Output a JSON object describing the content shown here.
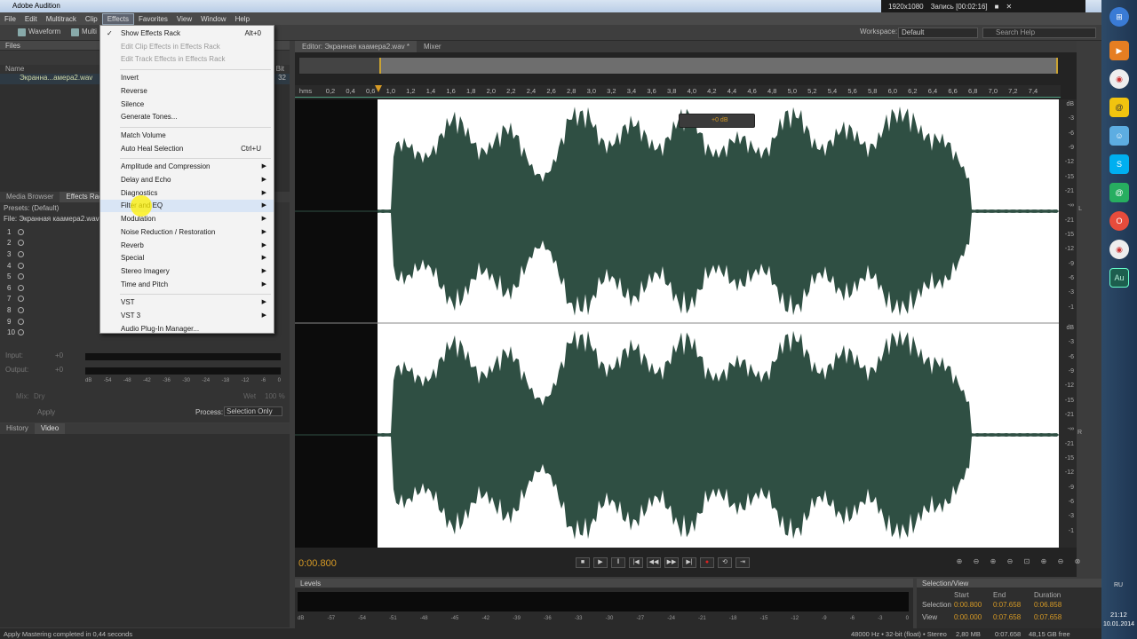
{
  "window": {
    "title": "Adobe Audition",
    "recorder": {
      "resolution": "1920x1080",
      "status": "Запись [00:02:16]"
    }
  },
  "menubar": {
    "items": [
      "File",
      "Edit",
      "Multitrack",
      "Clip",
      "Effects",
      "Favorites",
      "View",
      "Window",
      "Help"
    ],
    "active": "Effects"
  },
  "toolbar": {
    "waveform": "Waveform",
    "multitrack": "Multi",
    "workspace_label": "Workspace:",
    "workspace_value": "Default",
    "search_placeholder": "Search Help"
  },
  "files_panel": {
    "title": "Files",
    "col_name": "Name",
    "col_bit": "Bit",
    "file": "Экранна...амера2.wav",
    "bit": "32"
  },
  "effects_rack": {
    "tabs": [
      "Media Browser",
      "Effects Rack"
    ],
    "presets_label": "Presets:",
    "presets_value": "(Default)",
    "file_label": "File: Экранная каамера2.wav",
    "slots": [
      "1",
      "2",
      "3",
      "4",
      "5",
      "6",
      "7",
      "8",
      "9",
      "10"
    ],
    "input_label": "Input:",
    "output_label": "Output:",
    "input_val": "+0",
    "output_val": "+0",
    "mix_label": "Mix:",
    "dry": "Dry",
    "wet": "Wet",
    "mix_pct": "100 %",
    "meter_ticks": [
      "dB",
      "-54",
      "-48",
      "-42",
      "-36",
      "-30",
      "-24",
      "-18",
      "-12",
      "-6",
      "0"
    ],
    "apply": "Apply",
    "process_label": "Process:",
    "process_value": "Selection Only"
  },
  "lower_panel": {
    "tabs": [
      "History",
      "Video"
    ]
  },
  "effects_menu": {
    "items": [
      {
        "label": "Show Effects Rack",
        "shortcut": "Alt+0",
        "checked": true
      },
      {
        "label": "Edit Clip Effects in Effects Rack",
        "disabled": true
      },
      {
        "label": "Edit Track Effects in Effects Rack",
        "disabled": true
      },
      {
        "sep": true
      },
      {
        "label": "Invert"
      },
      {
        "label": "Reverse"
      },
      {
        "label": "Silence"
      },
      {
        "label": "Generate Tones..."
      },
      {
        "sep": true
      },
      {
        "label": "Match Volume"
      },
      {
        "label": "Auto Heal Selection",
        "shortcut": "Ctrl+U"
      },
      {
        "sep": true
      },
      {
        "label": "Amplitude and Compression",
        "sub": true
      },
      {
        "label": "Delay and Echo",
        "sub": true
      },
      {
        "label": "Diagnostics",
        "sub": true
      },
      {
        "label": "Filter and EQ",
        "sub": true,
        "highlight": true
      },
      {
        "label": "Modulation",
        "sub": true
      },
      {
        "label": "Noise Reduction / Restoration",
        "sub": true
      },
      {
        "label": "Reverb",
        "sub": true
      },
      {
        "label": "Special",
        "sub": true
      },
      {
        "label": "Stereo Imagery",
        "sub": true
      },
      {
        "label": "Time and Pitch",
        "sub": true
      },
      {
        "sep": true
      },
      {
        "label": "VST",
        "sub": true
      },
      {
        "label": "VST 3",
        "sub": true
      },
      {
        "label": "Audio Plug-In Manager..."
      }
    ]
  },
  "editor": {
    "tabs": [
      "Editor: Экранная каамера2.wav *",
      "Mixer"
    ],
    "ruler_unit": "hms",
    "ruler_ticks": [
      "0,2",
      "0,4",
      "0,6",
      "1,0",
      "1,2",
      "1,4",
      "1,6",
      "1,8",
      "2,0",
      "2,2",
      "2,4",
      "2,6",
      "2,8",
      "3,0",
      "3,2",
      "3,4",
      "3,6",
      "3,8",
      "4,0",
      "4,2",
      "4,4",
      "4,6",
      "4,8",
      "5,0",
      "5,2",
      "5,4",
      "5,6",
      "5,8",
      "6,0",
      "6,2",
      "6,4",
      "6,6",
      "6,8",
      "7,0",
      "7,2",
      "7,4"
    ],
    "volume_hud": "+0 dB",
    "db_scale": [
      "dB",
      "-3",
      "-6",
      "-9",
      "-12",
      "-15",
      "-21",
      "-∞",
      "-21",
      "-15",
      "-12",
      "-9",
      "-6",
      "-3",
      "-1"
    ],
    "channel_l": "L",
    "channel_r": "R",
    "timecode": "0:00.800"
  },
  "levels": {
    "title": "Levels",
    "ticks": [
      "dB",
      "-57",
      "-54",
      "-51",
      "-48",
      "-45",
      "-42",
      "-39",
      "-36",
      "-33",
      "-30",
      "-27",
      "-24",
      "-21",
      "-18",
      "-15",
      "-12",
      "-9",
      "-6",
      "-3",
      "0"
    ]
  },
  "selection_view": {
    "title": "Selection/View",
    "headers": [
      "Start",
      "End",
      "Duration"
    ],
    "selection": {
      "label": "Selection",
      "start": "0:00.800",
      "end": "0:07.658",
      "duration": "0:06.858"
    },
    "view": {
      "label": "View",
      "start": "0:00.000",
      "end": "0:07.658",
      "duration": "0:07.658"
    }
  },
  "status": {
    "message": "Apply Mastering completed in 0,44 seconds",
    "format": "48000 Hz • 32-bit (float) • Stereo",
    "size": "2,80 MB",
    "duration": "0:07.658",
    "free": "48,15 GB free"
  },
  "taskbar": {
    "lang": "RU",
    "time": "21:12",
    "date": "10.01.2014"
  },
  "colors": {
    "waveform": "#2f4f43",
    "accent": "#d69a25",
    "menu_bg": "#f3f3f3",
    "highlight": "#ffee00"
  }
}
